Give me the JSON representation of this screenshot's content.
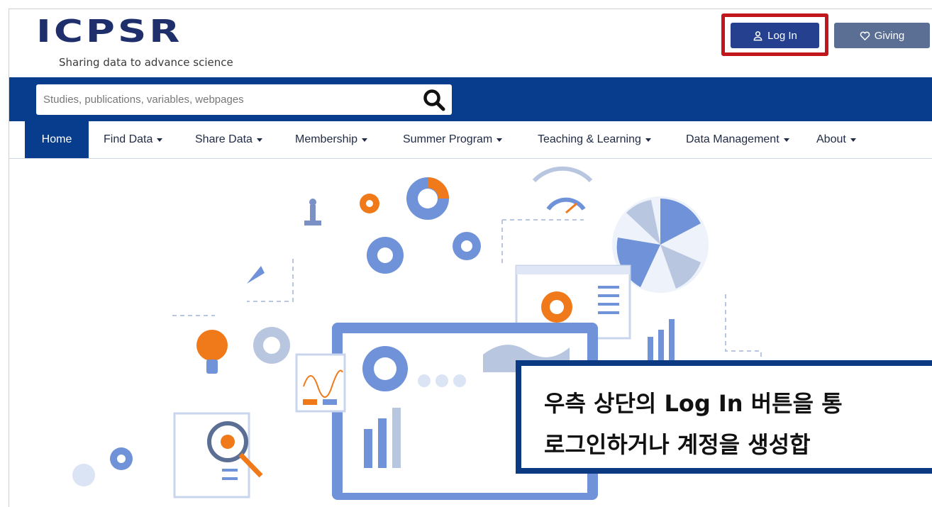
{
  "header": {
    "logo_text": "ICPSR",
    "tagline": "Sharing data to advance science",
    "login_label": "Log In",
    "giving_label": "Giving",
    "login_icon": "user-icon",
    "giving_icon": "heart-icon"
  },
  "search": {
    "placeholder": "Studies, publications, variables, webpages",
    "icon": "search-icon"
  },
  "nav": {
    "items": [
      {
        "label": "Home"
      },
      {
        "label": "Find Data"
      },
      {
        "label": "Share Data"
      },
      {
        "label": "Membership"
      },
      {
        "label": "Summer Program"
      },
      {
        "label": "Teaching & Learning"
      },
      {
        "label": "Data Management"
      },
      {
        "label": "About"
      }
    ]
  },
  "caption": {
    "line1": "우측 상단의 Log In 버튼을 통",
    "line2": "로그인하거나 계정을 생성합"
  },
  "colors": {
    "brand_navy": "#073d8c",
    "login_button": "#24408e",
    "giving_button": "#5b6f95",
    "highlight": "#c0161c",
    "illustration_blue": "#6f92d8",
    "illustration_orange": "#f07a1a"
  }
}
